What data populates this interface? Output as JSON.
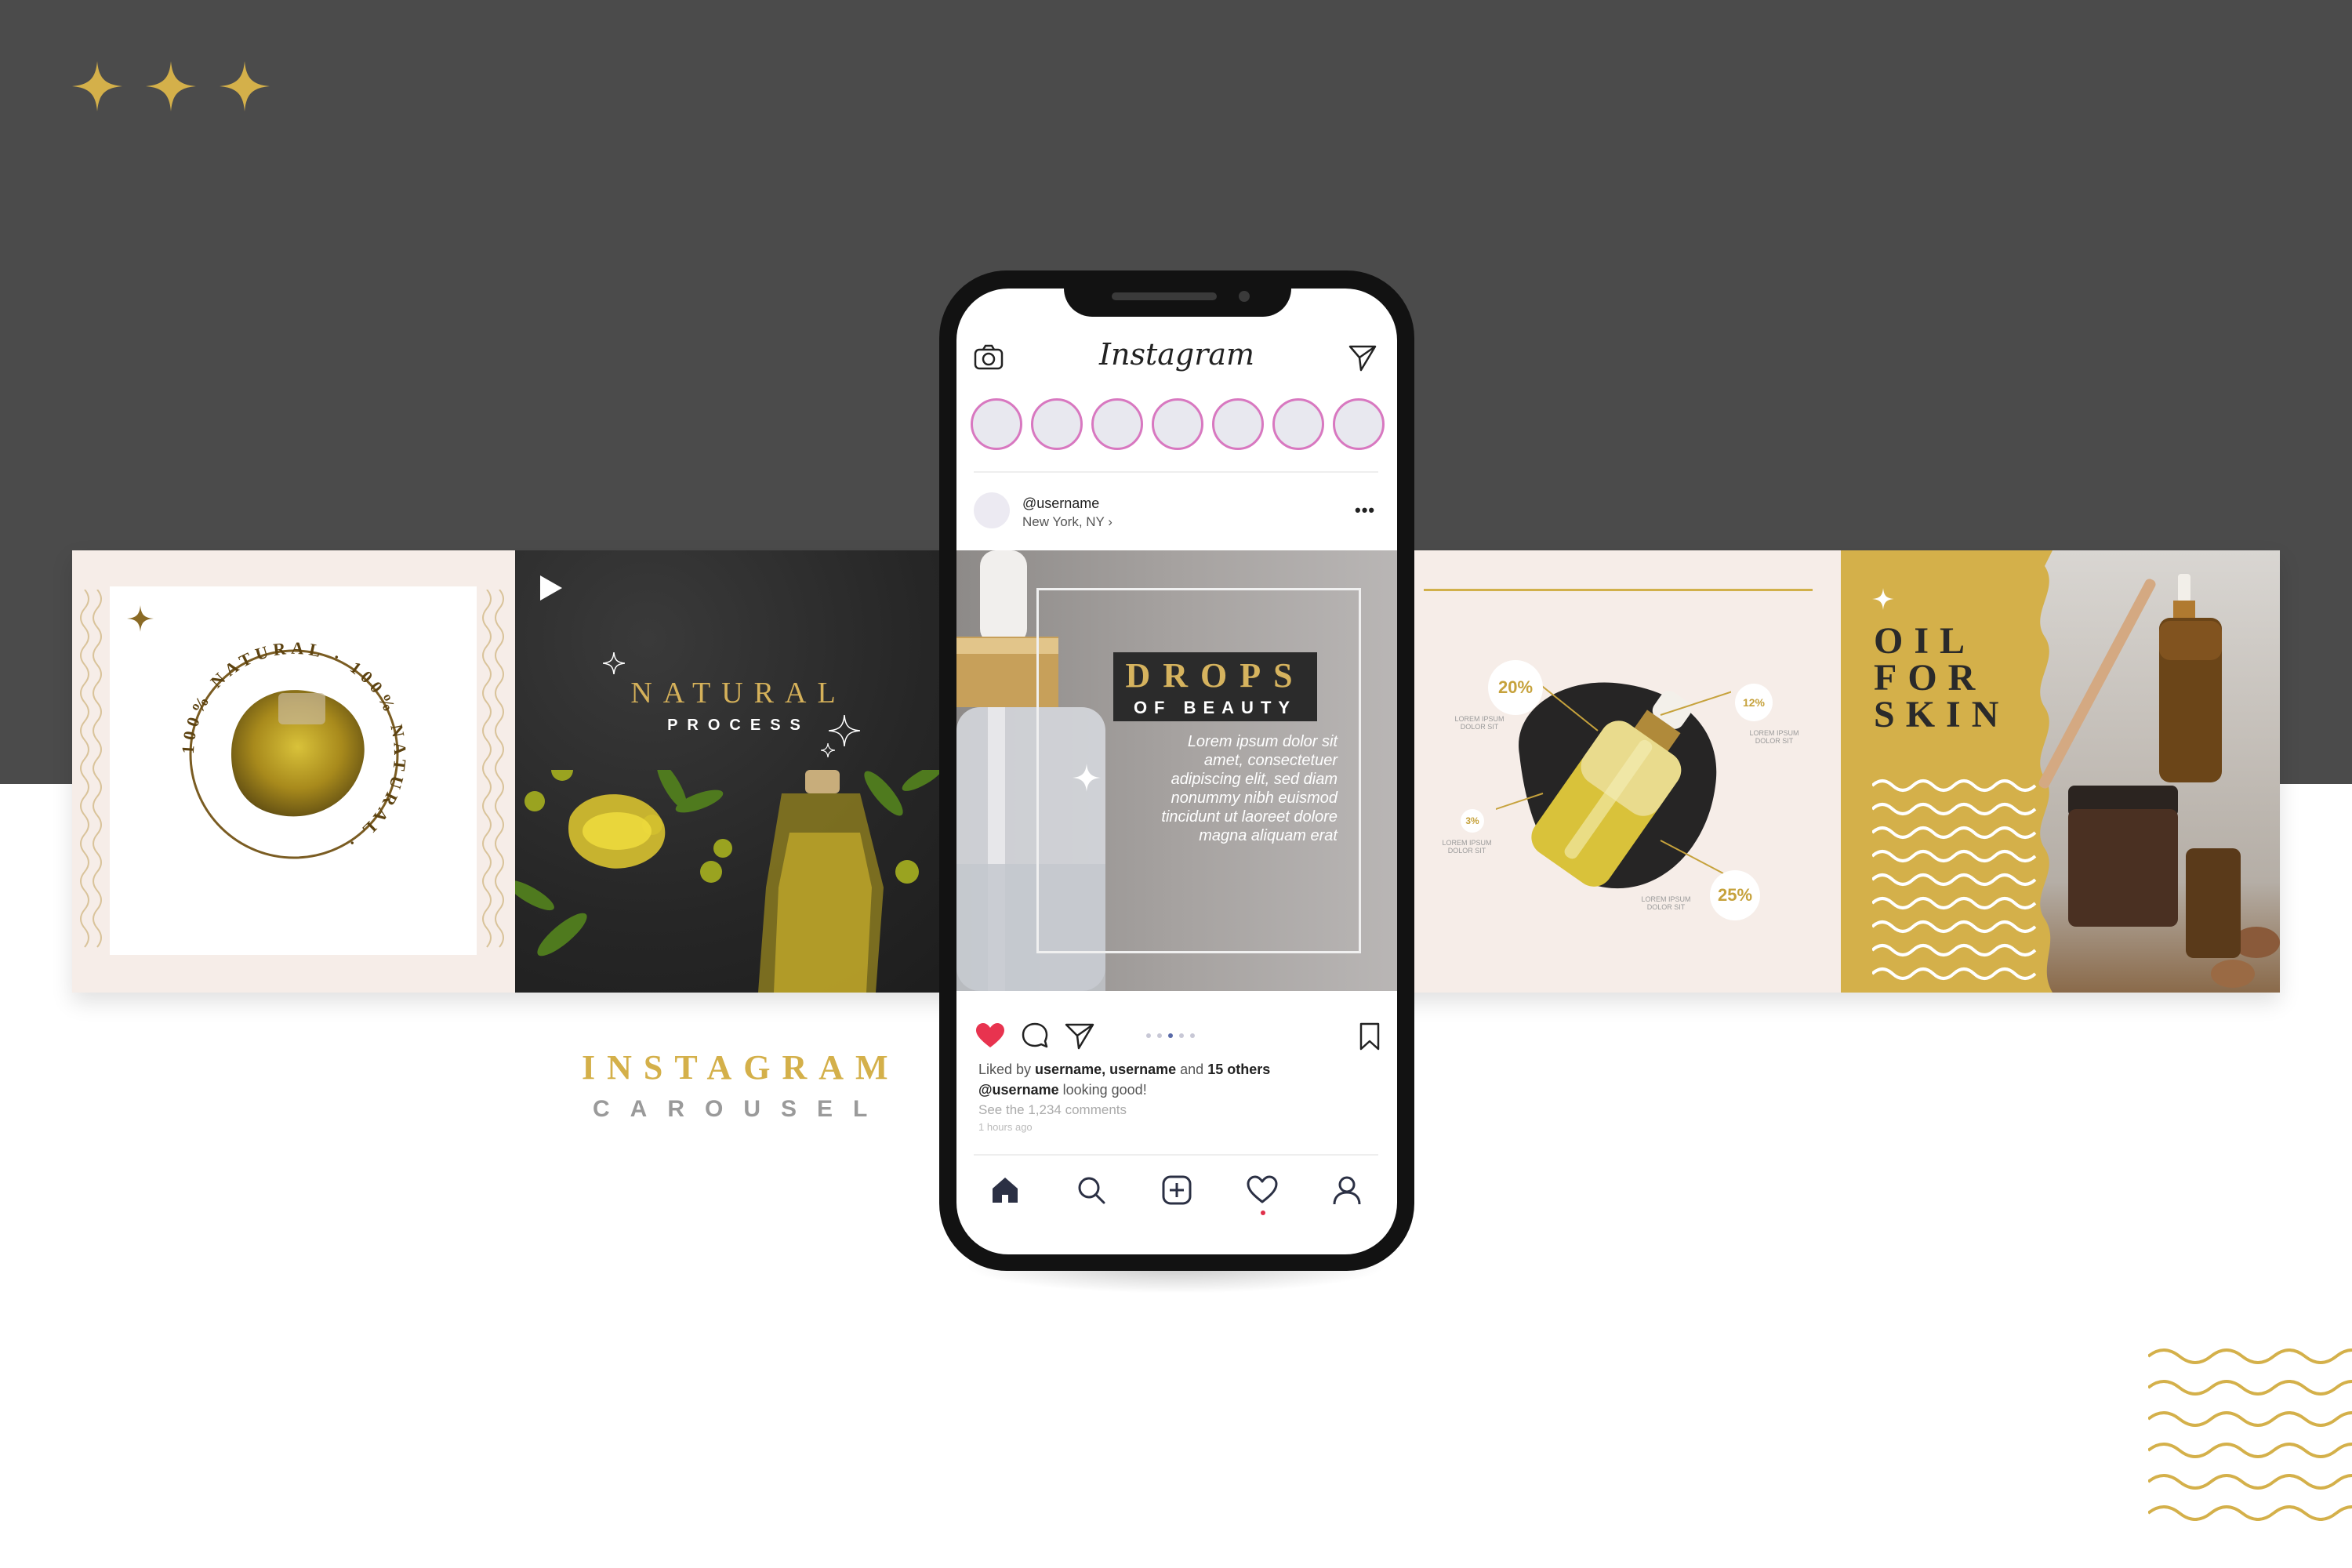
{
  "panel_natural": {
    "badge_text": "100% NATURAL · 100% NATURAL ·"
  },
  "panel_process": {
    "title": "NATURAL",
    "subtitle": "PROCESS"
  },
  "panel_chart": {
    "label_20": "20%",
    "label_12": "12%",
    "label_3": "3%",
    "label_25": "25%",
    "tiny_1": "LOREM IPSUM DOLOR SIT",
    "tiny_2": "LOREM IPSUM DOLOR SIT",
    "tiny_3": "LOREM IPSUM DOLOR SIT",
    "tiny_4": "LOREM IPSUM DOLOR SIT"
  },
  "panel_oil": {
    "line1": "OIL",
    "line2": "FOR",
    "line3": "SKIN"
  },
  "caption": {
    "line1": "INSTAGRAM",
    "line2": "CAROUSEL"
  },
  "phone": {
    "app_name": "Instagram",
    "post": {
      "username": "@username",
      "location": "New York, NY ›",
      "more": "•••",
      "title": "DROPS",
      "subtitle": "OF BEAUTY",
      "body": "Lorem ipsum dolor sit amet, consectetuer adipiscing elit, sed diam nonummy nibh euismod tincidunt ut laoreet dolore magna aliquam erat"
    },
    "liked_prefix": "Liked by ",
    "liked_users": "username, username",
    "liked_and": " and ",
    "liked_others": "15 others",
    "comment_user": "@username",
    "comment_text": " looking good!",
    "see_comments": "See the 1,234 comments",
    "time_ago": "1 hours ago"
  },
  "colors": {
    "gold": "#d4b04a",
    "dark_band": "#4b4b4b",
    "cream": "#f6ede8",
    "like_red": "#e8334f",
    "story_ring": "#d878c0"
  }
}
